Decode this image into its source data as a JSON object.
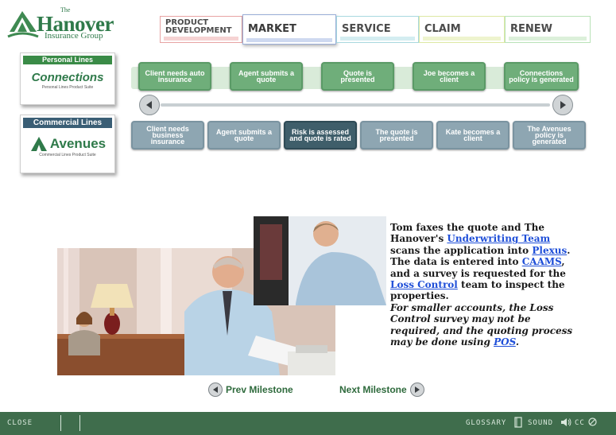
{
  "logo": {
    "the": "The",
    "name": "Hanover",
    "subtitle": "Insurance Group"
  },
  "tabs": [
    {
      "label": "PRODUCT DEVELOPMENT",
      "color": "#e46a6a"
    },
    {
      "label": "MARKET",
      "color": "#5a7fd0"
    },
    {
      "label": "SERVICE",
      "color": "#5bb8c8"
    },
    {
      "label": "CLAIM",
      "color": "#c8d84e"
    },
    {
      "label": "RENEW",
      "color": "#7ec77c"
    }
  ],
  "personal": {
    "header": "Personal Lines",
    "brand": "Connections",
    "brand_sub": "Personal Lines Product Suite",
    "color": "#3a8b47"
  },
  "commercial": {
    "header": "Commercial Lines",
    "brand": "Avenues",
    "brand_sub": "Commercial Lines Product Suite",
    "color": "#3a5e75"
  },
  "timeline_personal": [
    "Client needs auto insurance",
    "Agent submits a quote",
    "Quote is presented",
    "Joe becomes a client",
    "Connections policy is generated"
  ],
  "timeline_commercial": [
    "Client needs business insurance",
    "Agent submits a quote",
    "Risk is assessed and quote is rated",
    "The quote is presented",
    "Kate becomes a client",
    "The Avenues policy is generated"
  ],
  "content": {
    "p1_a": "Tom faxes the quote and The Hanover's ",
    "link_underwriting": "Underwriting Team",
    "p1_b": " scans the application into ",
    "link_plexus": "Plexus",
    "p1_c": ". The data is entered into ",
    "link_caams": "CAAMS",
    "p1_d": ", and a survey is requested for the ",
    "link_loss": "Loss Control",
    "p1_e": " team to inspect the properties.",
    "p2_a": "For smaller accounts, the Loss Control survey may not be required, and the quoting process may be done using ",
    "link_pos": "POS",
    "p2_b": "."
  },
  "nav": {
    "prev": "Prev Milestone",
    "next": "Next Milestone"
  },
  "footer": {
    "close": "CLOSE",
    "glossary": "GLOSSARY",
    "sound": "SOUND",
    "cc": "CC"
  }
}
